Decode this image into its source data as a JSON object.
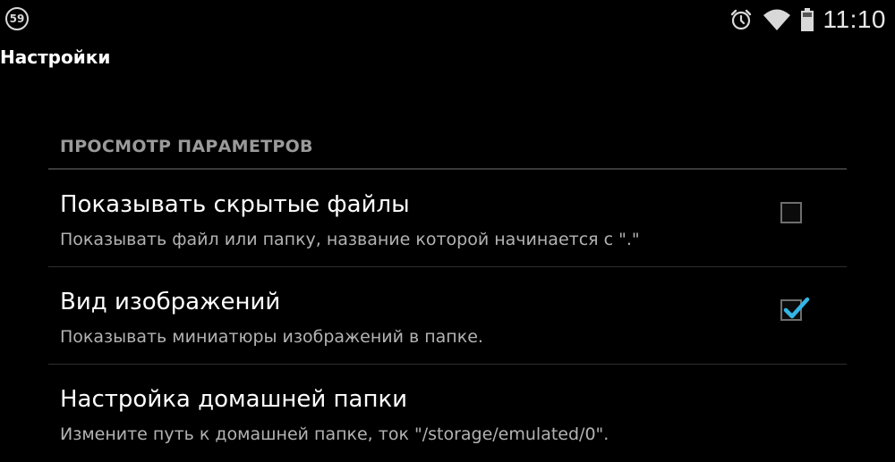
{
  "status_bar": {
    "notification_count": "59",
    "time": "11:10",
    "icons": [
      "alarm-icon",
      "wifi-icon",
      "battery-icon"
    ]
  },
  "action_bar": {
    "title": "Настройки"
  },
  "category": {
    "title": "ПРОСМОТР ПАРАМЕТРОВ"
  },
  "preferences": [
    {
      "title": "Показывать скрытые файлы",
      "summary": "Показывать файл или папку, название которой начинается с \".\"",
      "checked": false
    },
    {
      "title": "Вид изображений",
      "summary": "Показывать миниатюры изображений в папке.",
      "checked": true
    },
    {
      "title": "Настройка домашней папки",
      "summary": "Измените путь к домашней папке, ток \"/storage/emulated/0\"."
    }
  ],
  "colors": {
    "background": "#000000",
    "accent": "#33b5e5",
    "secondary_text": "#b3b3b3",
    "category_text": "#9a9a9a"
  }
}
